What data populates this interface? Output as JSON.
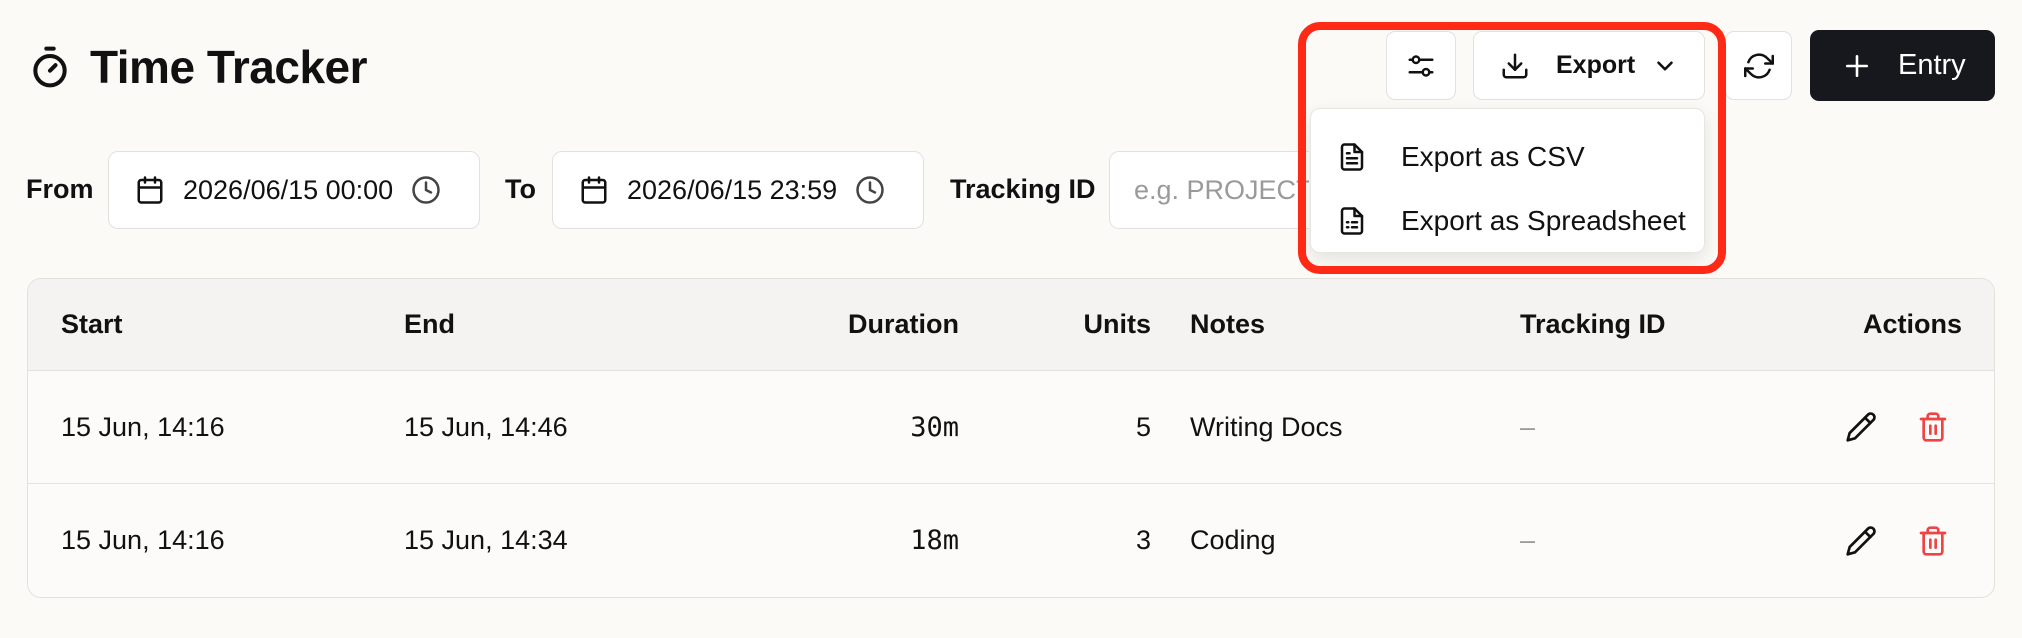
{
  "header": {
    "title": "Time Tracker",
    "icon": "stopwatch-icon"
  },
  "toolbar": {
    "filter_icon": "sliders-icon",
    "export_label": "Export",
    "export_icon": "download-icon",
    "refresh_icon": "refresh-icon",
    "entry_label": "Entry",
    "entry_icon": "plus-icon"
  },
  "export_menu": {
    "items": [
      {
        "label": "Export as CSV",
        "icon": "file-text-icon"
      },
      {
        "label": "Export as Spreadsheet",
        "icon": "spreadsheet-icon"
      }
    ],
    "highlight_color": "#ff2a16"
  },
  "filters": {
    "from_label": "From",
    "from_value": "2026/06/15 00:00",
    "to_label": "To",
    "to_value": "2026/06/15 23:59",
    "tracking_id_label": "Tracking ID",
    "tracking_id_placeholder": "e.g. PROJECT-",
    "tracking_id_value": ""
  },
  "table": {
    "columns": [
      "Start",
      "End",
      "Duration",
      "Units",
      "Notes",
      "Tracking ID",
      "Actions"
    ],
    "rows": [
      {
        "start": "15 Jun, 14:16",
        "end": "15 Jun, 14:46",
        "duration": "30m",
        "units": "5",
        "notes": "Writing Docs",
        "tracking_id": "–"
      },
      {
        "start": "15 Jun, 14:16",
        "end": "15 Jun, 14:34",
        "duration": "18m",
        "units": "3",
        "notes": "Coding",
        "tracking_id": "–"
      }
    ]
  },
  "colors": {
    "accent_dark": "#17181d",
    "delete_red": "#ef4444",
    "background": "#fbfaf7"
  }
}
